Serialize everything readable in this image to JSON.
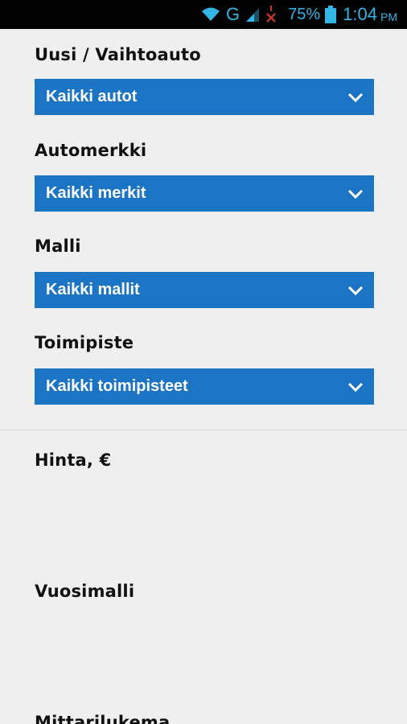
{
  "status_bar": {
    "network": "G",
    "battery_percent": "75%",
    "time": "1:04",
    "ampm": "PM",
    "accent_color": "#33b5e5"
  },
  "filters": [
    {
      "label": "Uusi / Vaihtoauto",
      "value": "Kaikki autot"
    },
    {
      "label": "Automerkki",
      "value": "Kaikki merkit"
    },
    {
      "label": "Malli",
      "value": "Kaikki mallit"
    },
    {
      "label": "Toimipiste",
      "value": "Kaikki toimipisteet"
    }
  ],
  "ranges": {
    "price_label": "Hinta, €",
    "year_label": "Vuosimalli",
    "mileage_label": "Mittarilukema"
  },
  "colors": {
    "select_bg": "#1b74c4",
    "page_bg": "#efefef"
  }
}
